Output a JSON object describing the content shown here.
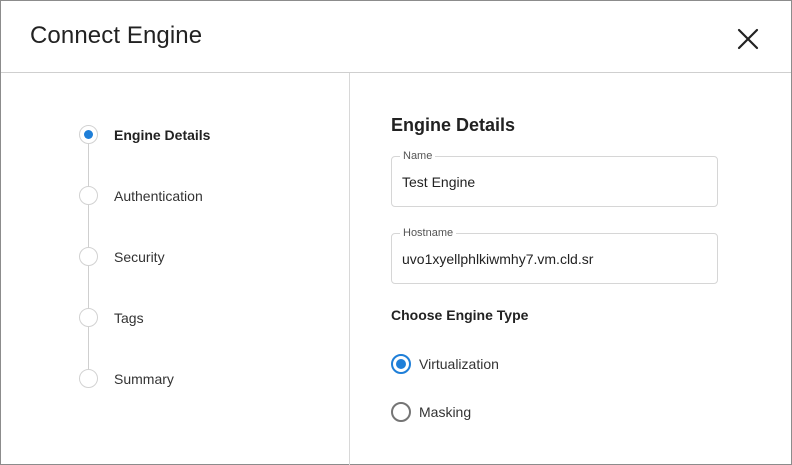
{
  "dialog": {
    "title": "Connect Engine",
    "close_icon": "close-icon"
  },
  "steps": [
    {
      "label": "Engine Details",
      "active": true
    },
    {
      "label": "Authentication",
      "active": false
    },
    {
      "label": "Security",
      "active": false
    },
    {
      "label": "Tags",
      "active": false
    },
    {
      "label": "Summary",
      "active": false
    }
  ],
  "form": {
    "section_title": "Engine Details",
    "name": {
      "label": "Name",
      "value": "Test Engine"
    },
    "hostname": {
      "label": "Hostname",
      "value": "uvo1xyellphlkiwmhy7.vm.cld.sr"
    },
    "engine_type": {
      "heading": "Choose Engine Type",
      "options": [
        {
          "label": "Virtualization",
          "checked": true
        },
        {
          "label": "Masking",
          "checked": false
        }
      ]
    }
  },
  "colors": {
    "accent": "#1f7fd8",
    "border": "#d6d6d6"
  }
}
